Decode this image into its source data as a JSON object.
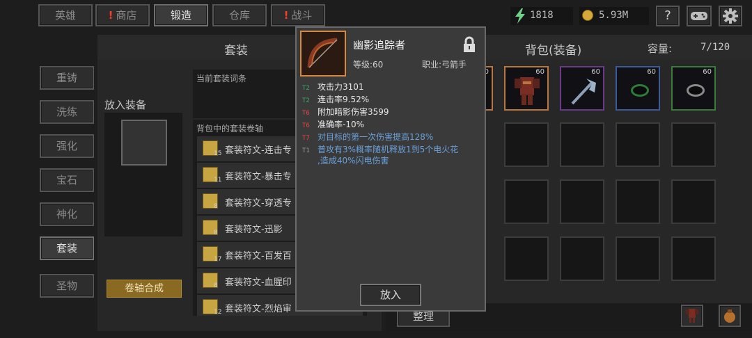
{
  "top_tabs": [
    {
      "label": "英雄",
      "active": false,
      "alert": false
    },
    {
      "label": "商店",
      "active": false,
      "alert": true
    },
    {
      "label": "锻造",
      "active": true,
      "alert": false
    },
    {
      "label": "仓库",
      "active": false,
      "alert": false
    },
    {
      "label": "战斗",
      "active": false,
      "alert": true
    }
  ],
  "currency": {
    "energy": "1818",
    "gold": "5.93M"
  },
  "top_right": {
    "help": "?"
  },
  "sidebar": [
    "重铸",
    "洗练",
    "强化",
    "宝石",
    "神化",
    "套装",
    "圣物"
  ],
  "sidebar_active": "套装",
  "left_panel": {
    "title": "套装",
    "put_label": "放入装备",
    "current_affix_label": "当前套装词条",
    "scrolls_label": "背包中的套装卷轴",
    "scrolls": [
      {
        "count": "15",
        "name": "套装符文-连击专"
      },
      {
        "count": "11",
        "name": "套装符文-暴击专"
      },
      {
        "count": "8",
        "name": "套装符文-穿透专"
      },
      {
        "count": "8",
        "name": "套装符文-迅影"
      },
      {
        "count": "17",
        "name": "套装符文-百发百"
      },
      {
        "count": "8",
        "name": "套装符文-血腥印"
      },
      {
        "count": "12",
        "name": "套装符文-烈焰审"
      }
    ],
    "synthesize_btn": "卷轴合成"
  },
  "bag": {
    "title": "背包(装备)",
    "capacity_label": "容量:",
    "capacity": "7/120",
    "sort_btn": "整理",
    "items": [
      {
        "level": "60",
        "kind": "armor"
      },
      {
        "level": "60",
        "kind": "axe"
      },
      {
        "level": "60",
        "kind": "ring-blue"
      },
      {
        "level": "60",
        "kind": "ring-green"
      }
    ],
    "first_item_level": "60"
  },
  "tooltip": {
    "name": "幽影追踪者",
    "level_label": "等级:60",
    "class_label": "职业:弓箭手",
    "stats": [
      {
        "tier": "T2",
        "text": "攻击力3101",
        "tier_class": "t2",
        "text_class": "stat-white"
      },
      {
        "tier": "T2",
        "text": "连击率9.52%",
        "tier_class": "t2",
        "text_class": "stat-white"
      },
      {
        "tier": "T6",
        "text": "附加暗影伤害3599",
        "tier_class": "t6",
        "text_class": "stat-white"
      },
      {
        "tier": "T6",
        "text": "准确率-10%",
        "tier_class": "t6",
        "text_class": "stat-white"
      },
      {
        "tier": "T7",
        "text": "对目标的第一次伤害提高128%",
        "tier_class": "t7",
        "text_class": "stat-blue"
      },
      {
        "tier": "T1",
        "text": "普攻有3%概率随机释放1到5个电火花",
        "tier_class": "t1",
        "text_class": "stat-blue"
      },
      {
        "tier": "",
        "text": ",造成40%闪电伤害",
        "tier_class": "t1",
        "text_class": "stat-blue"
      }
    ],
    "put_btn": "放入"
  },
  "colors": {
    "gold": "#c9a43b",
    "tooltip_bg": "#3a3a3a",
    "blue_stat": "#6aa0d8",
    "green_tier": "#3fa86a",
    "red_tier": "#e24848"
  }
}
